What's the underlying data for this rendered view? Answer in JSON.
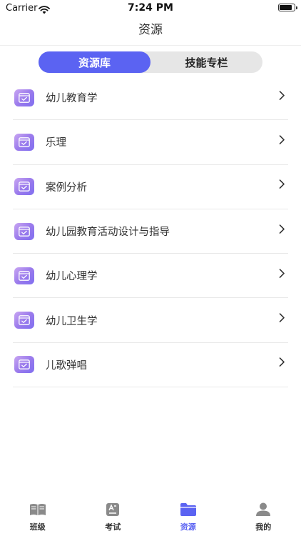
{
  "status_bar": {
    "carrier": "Carrier",
    "time": "7:24 PM",
    "battery_level": 0.85
  },
  "header": {
    "title": "资源"
  },
  "segment": {
    "tabs": [
      {
        "label": "资源库",
        "active": true
      },
      {
        "label": "技能专栏",
        "active": false
      }
    ]
  },
  "resources": {
    "items": [
      {
        "label": "幼儿教育学",
        "icon": "folder-check-icon"
      },
      {
        "label": "乐理",
        "icon": "folder-check-icon"
      },
      {
        "label": "案例分析",
        "icon": "folder-check-icon"
      },
      {
        "label": "幼儿园教育活动设计与指导",
        "icon": "folder-check-icon"
      },
      {
        "label": "幼儿心理学",
        "icon": "folder-check-icon"
      },
      {
        "label": "幼儿卫生学",
        "icon": "folder-check-icon"
      },
      {
        "label": "儿歌弹唱",
        "icon": "folder-check-icon"
      }
    ]
  },
  "tab_bar": {
    "items": [
      {
        "label": "班级",
        "icon": "book-icon",
        "active": false
      },
      {
        "label": "考试",
        "icon": "exam-icon",
        "active": false
      },
      {
        "label": "资源",
        "icon": "folder-icon",
        "active": true
      },
      {
        "label": "我的",
        "icon": "person-icon",
        "active": false
      }
    ]
  },
  "colors": {
    "accent": "#5b63f2",
    "segment_bg": "#e6e6e6",
    "divider": "#e8e8e8"
  }
}
